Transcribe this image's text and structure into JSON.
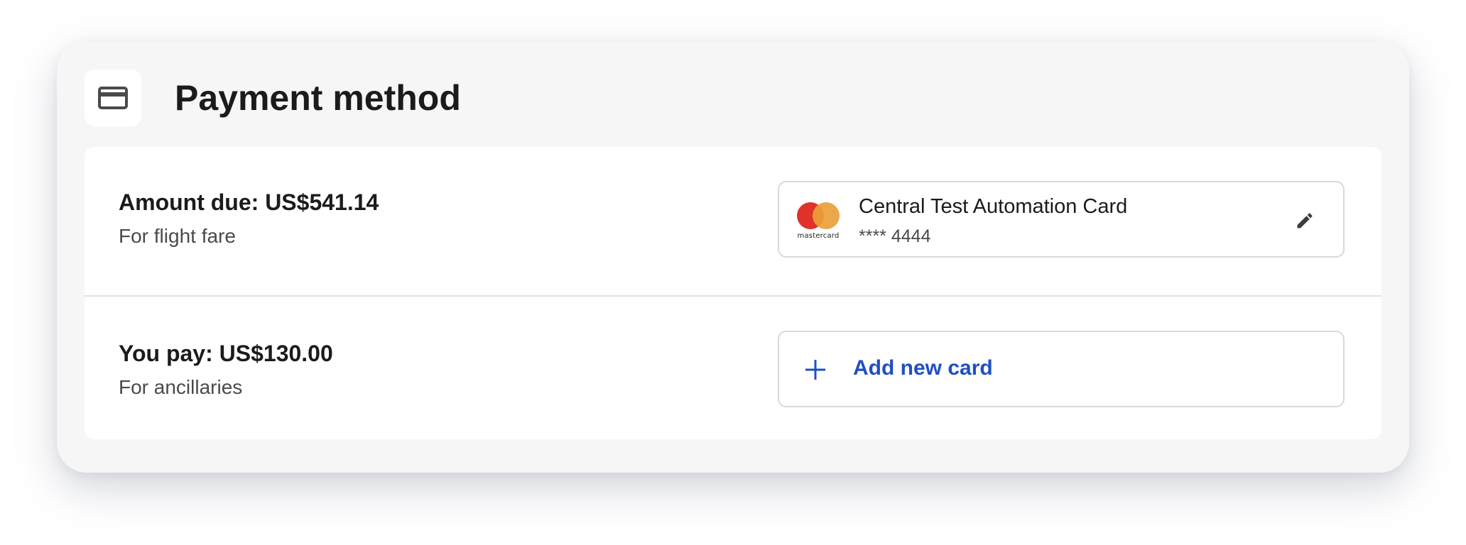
{
  "header": {
    "title": "Payment method",
    "icon": "credit-card-icon"
  },
  "rows": [
    {
      "amount": "Amount due: US$541.14",
      "description": "For flight fare",
      "saved_card": {
        "name": "Central Test Automation Card",
        "number": "**** 4444",
        "brand": "mastercard",
        "brand_icon": "mastercard-icon",
        "edit_icon": "pencil-icon"
      }
    },
    {
      "amount": "You pay: US$130.00",
      "description": "For ancillaries",
      "add_card": {
        "label": "Add new card",
        "icon": "plus-icon"
      }
    }
  ],
  "colors": {
    "accent": "#1f4fc4",
    "mastercard_red": "#e0312b",
    "mastercard_orange": "#eaa03a",
    "card_background": "#f6f6f6",
    "text_primary": "#1b1b1b",
    "text_secondary": "#4a4a4a"
  }
}
